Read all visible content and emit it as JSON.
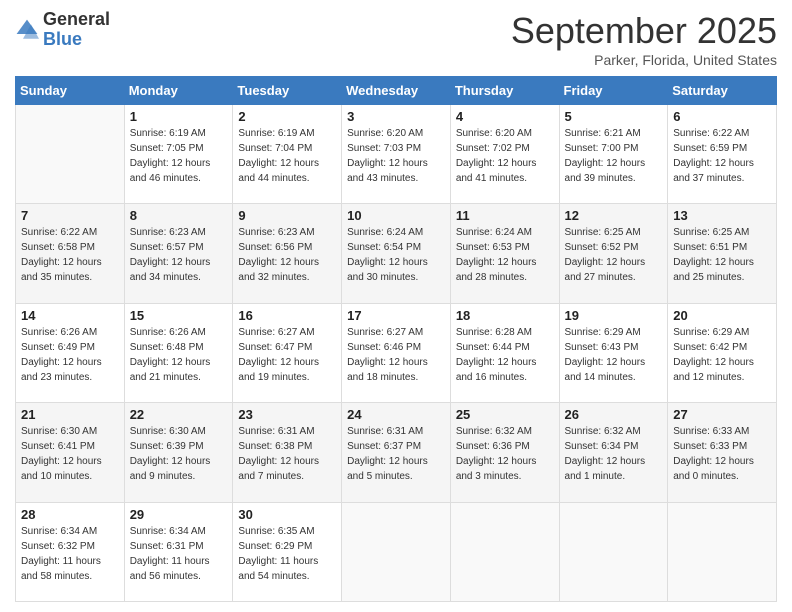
{
  "logo": {
    "general": "General",
    "blue": "Blue"
  },
  "header": {
    "month": "September 2025",
    "location": "Parker, Florida, United States"
  },
  "days_of_week": [
    "Sunday",
    "Monday",
    "Tuesday",
    "Wednesday",
    "Thursday",
    "Friday",
    "Saturday"
  ],
  "weeks": [
    [
      {
        "day": "",
        "info": ""
      },
      {
        "day": "1",
        "sunrise": "Sunrise: 6:19 AM",
        "sunset": "Sunset: 7:05 PM",
        "daylight": "Daylight: 12 hours and 46 minutes."
      },
      {
        "day": "2",
        "sunrise": "Sunrise: 6:19 AM",
        "sunset": "Sunset: 7:04 PM",
        "daylight": "Daylight: 12 hours and 44 minutes."
      },
      {
        "day": "3",
        "sunrise": "Sunrise: 6:20 AM",
        "sunset": "Sunset: 7:03 PM",
        "daylight": "Daylight: 12 hours and 43 minutes."
      },
      {
        "day": "4",
        "sunrise": "Sunrise: 6:20 AM",
        "sunset": "Sunset: 7:02 PM",
        "daylight": "Daylight: 12 hours and 41 minutes."
      },
      {
        "day": "5",
        "sunrise": "Sunrise: 6:21 AM",
        "sunset": "Sunset: 7:00 PM",
        "daylight": "Daylight: 12 hours and 39 minutes."
      },
      {
        "day": "6",
        "sunrise": "Sunrise: 6:22 AM",
        "sunset": "Sunset: 6:59 PM",
        "daylight": "Daylight: 12 hours and 37 minutes."
      }
    ],
    [
      {
        "day": "7",
        "sunrise": "Sunrise: 6:22 AM",
        "sunset": "Sunset: 6:58 PM",
        "daylight": "Daylight: 12 hours and 35 minutes."
      },
      {
        "day": "8",
        "sunrise": "Sunrise: 6:23 AM",
        "sunset": "Sunset: 6:57 PM",
        "daylight": "Daylight: 12 hours and 34 minutes."
      },
      {
        "day": "9",
        "sunrise": "Sunrise: 6:23 AM",
        "sunset": "Sunset: 6:56 PM",
        "daylight": "Daylight: 12 hours and 32 minutes."
      },
      {
        "day": "10",
        "sunrise": "Sunrise: 6:24 AM",
        "sunset": "Sunset: 6:54 PM",
        "daylight": "Daylight: 12 hours and 30 minutes."
      },
      {
        "day": "11",
        "sunrise": "Sunrise: 6:24 AM",
        "sunset": "Sunset: 6:53 PM",
        "daylight": "Daylight: 12 hours and 28 minutes."
      },
      {
        "day": "12",
        "sunrise": "Sunrise: 6:25 AM",
        "sunset": "Sunset: 6:52 PM",
        "daylight": "Daylight: 12 hours and 27 minutes."
      },
      {
        "day": "13",
        "sunrise": "Sunrise: 6:25 AM",
        "sunset": "Sunset: 6:51 PM",
        "daylight": "Daylight: 12 hours and 25 minutes."
      }
    ],
    [
      {
        "day": "14",
        "sunrise": "Sunrise: 6:26 AM",
        "sunset": "Sunset: 6:49 PM",
        "daylight": "Daylight: 12 hours and 23 minutes."
      },
      {
        "day": "15",
        "sunrise": "Sunrise: 6:26 AM",
        "sunset": "Sunset: 6:48 PM",
        "daylight": "Daylight: 12 hours and 21 minutes."
      },
      {
        "day": "16",
        "sunrise": "Sunrise: 6:27 AM",
        "sunset": "Sunset: 6:47 PM",
        "daylight": "Daylight: 12 hours and 19 minutes."
      },
      {
        "day": "17",
        "sunrise": "Sunrise: 6:27 AM",
        "sunset": "Sunset: 6:46 PM",
        "daylight": "Daylight: 12 hours and 18 minutes."
      },
      {
        "day": "18",
        "sunrise": "Sunrise: 6:28 AM",
        "sunset": "Sunset: 6:44 PM",
        "daylight": "Daylight: 12 hours and 16 minutes."
      },
      {
        "day": "19",
        "sunrise": "Sunrise: 6:29 AM",
        "sunset": "Sunset: 6:43 PM",
        "daylight": "Daylight: 12 hours and 14 minutes."
      },
      {
        "day": "20",
        "sunrise": "Sunrise: 6:29 AM",
        "sunset": "Sunset: 6:42 PM",
        "daylight": "Daylight: 12 hours and 12 minutes."
      }
    ],
    [
      {
        "day": "21",
        "sunrise": "Sunrise: 6:30 AM",
        "sunset": "Sunset: 6:41 PM",
        "daylight": "Daylight: 12 hours and 10 minutes."
      },
      {
        "day": "22",
        "sunrise": "Sunrise: 6:30 AM",
        "sunset": "Sunset: 6:39 PM",
        "daylight": "Daylight: 12 hours and 9 minutes."
      },
      {
        "day": "23",
        "sunrise": "Sunrise: 6:31 AM",
        "sunset": "Sunset: 6:38 PM",
        "daylight": "Daylight: 12 hours and 7 minutes."
      },
      {
        "day": "24",
        "sunrise": "Sunrise: 6:31 AM",
        "sunset": "Sunset: 6:37 PM",
        "daylight": "Daylight: 12 hours and 5 minutes."
      },
      {
        "day": "25",
        "sunrise": "Sunrise: 6:32 AM",
        "sunset": "Sunset: 6:36 PM",
        "daylight": "Daylight: 12 hours and 3 minutes."
      },
      {
        "day": "26",
        "sunrise": "Sunrise: 6:32 AM",
        "sunset": "Sunset: 6:34 PM",
        "daylight": "Daylight: 12 hours and 1 minute."
      },
      {
        "day": "27",
        "sunrise": "Sunrise: 6:33 AM",
        "sunset": "Sunset: 6:33 PM",
        "daylight": "Daylight: 12 hours and 0 minutes."
      }
    ],
    [
      {
        "day": "28",
        "sunrise": "Sunrise: 6:34 AM",
        "sunset": "Sunset: 6:32 PM",
        "daylight": "Daylight: 11 hours and 58 minutes."
      },
      {
        "day": "29",
        "sunrise": "Sunrise: 6:34 AM",
        "sunset": "Sunset: 6:31 PM",
        "daylight": "Daylight: 11 hours and 56 minutes."
      },
      {
        "day": "30",
        "sunrise": "Sunrise: 6:35 AM",
        "sunset": "Sunset: 6:29 PM",
        "daylight": "Daylight: 11 hours and 54 minutes."
      },
      {
        "day": "",
        "info": ""
      },
      {
        "day": "",
        "info": ""
      },
      {
        "day": "",
        "info": ""
      },
      {
        "day": "",
        "info": ""
      }
    ]
  ]
}
